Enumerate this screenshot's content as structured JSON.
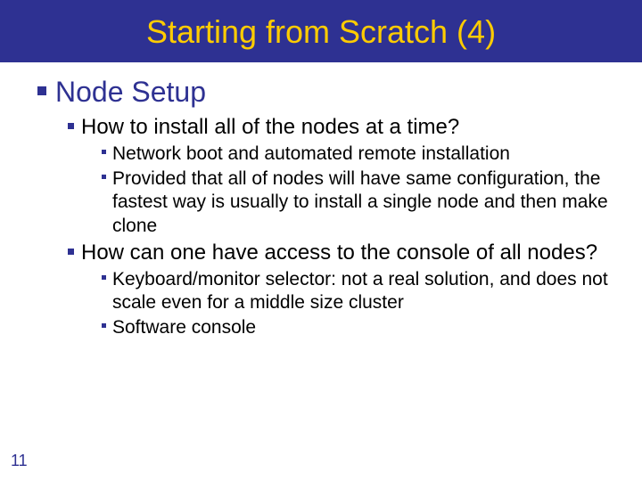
{
  "title": "Starting from Scratch (4)",
  "heading": "Node Setup",
  "q1": "How to install all of the nodes at a time?",
  "q1_items": {
    "a": "Network boot and automated remote installation",
    "b": "Provided that all of nodes will have same configuration, the fastest way is usually to install a single node and then make clone"
  },
  "q2": "How can one have access to the console of all nodes?",
  "q2_items": {
    "a": "Keyboard/monitor selector: not a real solution, and does not scale even for a middle size cluster",
    "b": "Software console"
  },
  "page_number": "11"
}
